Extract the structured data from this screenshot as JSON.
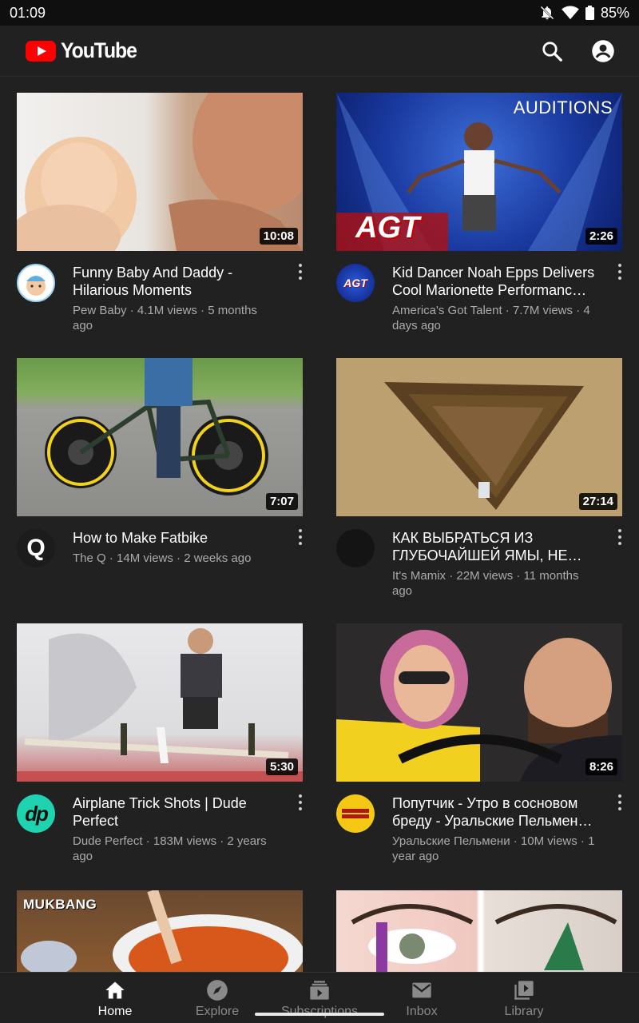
{
  "status": {
    "time": "01:09",
    "battery": "85%"
  },
  "app": {
    "name": "YouTube"
  },
  "header": {
    "search_icon": "search-icon",
    "account_icon": "account-icon"
  },
  "videos": [
    {
      "title": "Funny Baby And Daddy - Hilarious Moments",
      "sub": "Pew Baby · 4.1M views · 5 months ago",
      "duration": "10:08"
    },
    {
      "title": "Kid Dancer Noah Epps Delivers Cool Marionette Performanc…",
      "sub": "America's Got Talent · 7.7M views · 4 days ago",
      "duration": "2:26",
      "overlay": "AUDITIONS",
      "overlay2": "AGT",
      "avatar_text": "AGT"
    },
    {
      "title": "How to Make Fatbike",
      "sub": "The Q · 14M views · 2 weeks ago",
      "duration": "7:07",
      "avatar_text": "Q"
    },
    {
      "title": "КАК ВЫБРАТЬСЯ ИЗ ГЛУБОЧАЙШЕЙ ЯМЫ, НЕ И…",
      "sub": "It's Mamix · 22M views · 11 months ago",
      "duration": "27:14"
    },
    {
      "title": "Airplane Trick Shots | Dude Perfect",
      "sub": "Dude Perfect · 183M views · 2 years ago",
      "duration": "5:30",
      "avatar_text": "dp"
    },
    {
      "title": "Попутчик - Утро в сосновом бреду - Уральские Пельмен…",
      "sub": "Уральские Пельмени · 10M views · 1 year ago",
      "duration": "8:26"
    },
    {
      "overlay": "MUKBANG"
    },
    {}
  ],
  "nav": [
    {
      "label": "Home",
      "icon": "home-icon"
    },
    {
      "label": "Explore",
      "icon": "explore-icon"
    },
    {
      "label": "Subscriptions",
      "icon": "subscriptions-icon"
    },
    {
      "label": "Inbox",
      "icon": "inbox-icon"
    },
    {
      "label": "Library",
      "icon": "library-icon"
    }
  ]
}
